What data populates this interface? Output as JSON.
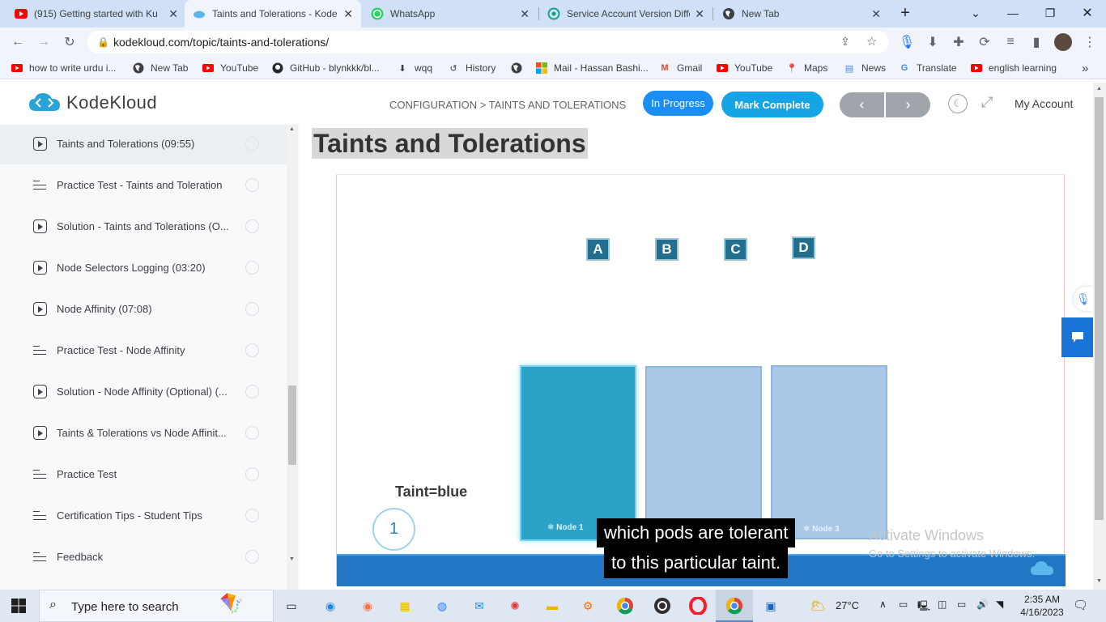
{
  "tabs": [
    {
      "title": "(915) Getting started with Ku",
      "icon": "youtube-icon"
    },
    {
      "title": "Taints and Tolerations - Kode",
      "icon": "kodekloud-icon"
    },
    {
      "title": "WhatsApp",
      "icon": "whatsapp-icon"
    },
    {
      "title": "Service Account Version Diffe",
      "icon": "openai-icon"
    },
    {
      "title": "New Tab",
      "icon": "globe-icon"
    }
  ],
  "new_tab_symbol": "+",
  "address_bar": {
    "url": "kodekloud.com/topic/taints-and-tolerations/"
  },
  "bookmarks": [
    {
      "label": "how to write urdu i...",
      "icon": "youtube-icon"
    },
    {
      "label": "New Tab",
      "icon": "globe-icon"
    },
    {
      "label": "YouTube",
      "icon": "youtube-icon"
    },
    {
      "label": "GitHub - blynkkk/bl...",
      "icon": "github-icon"
    },
    {
      "label": "wqq",
      "icon": "download-icon"
    },
    {
      "label": "History",
      "icon": "history-icon"
    },
    {
      "label": "",
      "icon": "globe-icon"
    },
    {
      "label": "Mail - Hassan Bashi...",
      "icon": "microsoft-icon"
    },
    {
      "label": "Gmail",
      "icon": "gmail-icon"
    },
    {
      "label": "YouTube",
      "icon": "youtube-icon"
    },
    {
      "label": "Maps",
      "icon": "maps-icon"
    },
    {
      "label": "News",
      "icon": "news-icon"
    },
    {
      "label": "Translate",
      "icon": "translate-icon"
    },
    {
      "label": "english learning",
      "icon": "youtube-icon"
    }
  ],
  "bookmarks_overflow": "»",
  "header": {
    "logo": "KodeKloud",
    "breadcrumb": "CONFIGURATION > TAINTS AND TOLERATIONS",
    "status": "In Progress",
    "mark_complete": "Mark Complete",
    "prev": "‹",
    "next": "›",
    "account": "My Account"
  },
  "sidebar": {
    "items": [
      {
        "title": "Taints and Tolerations (09:55)",
        "type": "video",
        "current": true
      },
      {
        "title": "Practice Test - Taints and Toleration",
        "type": "lab"
      },
      {
        "title": "Solution - Taints and Tolerations (O...",
        "type": "video"
      },
      {
        "title": "Node Selectors Logging (03:20)",
        "type": "video"
      },
      {
        "title": "Node Affinity (07:08)",
        "type": "video"
      },
      {
        "title": "Practice Test - Node Affinity",
        "type": "lab"
      },
      {
        "title": "Solution - Node Affinity (Optional) (...",
        "type": "video"
      },
      {
        "title": "Taints & Tolerations vs Node Affinit...",
        "type": "video"
      },
      {
        "title": "Practice Test",
        "type": "lab"
      },
      {
        "title": "Certification Tips - Student Tips",
        "type": "lab"
      },
      {
        "title": "Feedback",
        "type": "lab"
      }
    ]
  },
  "main": {
    "title": "Taints and Tolerations",
    "video": {
      "pods": [
        "A",
        "B",
        "C",
        "D"
      ],
      "taint_label": "Taint=blue",
      "node_number": "1",
      "node_labels": [
        "Node 1",
        "Node 3"
      ],
      "caption_line1": "which pods are tolerant",
      "caption_line2": "to this particular taint.",
      "watermark_line1": "Activate Windows",
      "watermark_line2": "Go to Settings to activate Windows."
    }
  },
  "taskbar": {
    "search_placeholder": "Type here to search",
    "weather": "27°C",
    "time": "2:35 AM",
    "date": "4/16/2023"
  }
}
